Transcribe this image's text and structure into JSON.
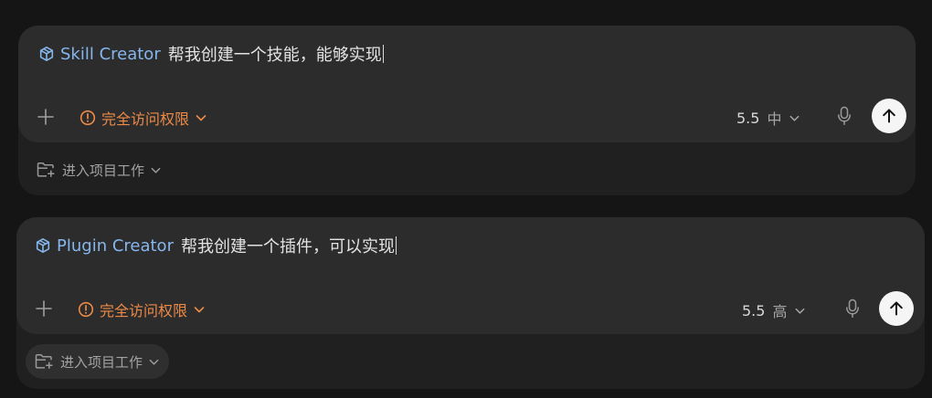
{
  "panels": [
    {
      "creator_label": "Skill Creator",
      "prompt_text": "帮我创建一个技能，能够实现",
      "access_label": "完全访问权限",
      "model_version": "5.5",
      "effort_level": "中",
      "project_label": "进入项目工作"
    },
    {
      "creator_label": "Plugin Creator",
      "prompt_text": "帮我创建一个插件，可以实现",
      "access_label": "完全访问权限",
      "model_version": "5.5",
      "effort_level": "高",
      "project_label": "进入项目工作"
    }
  ],
  "colors": {
    "background": "#151515",
    "frame": "#202020",
    "composer": "#2c2c2c",
    "creator_tag": "#86b6ec",
    "access_warning": "#ec8a48",
    "send_button": "#f5f5f5"
  },
  "icons": {
    "creator": "cube-icon",
    "add": "plus-icon",
    "access": "warning-circle-icon",
    "dropdown": "chevron-down-icon",
    "mic": "microphone-icon",
    "send": "arrow-up-icon",
    "project": "folder-icon"
  }
}
